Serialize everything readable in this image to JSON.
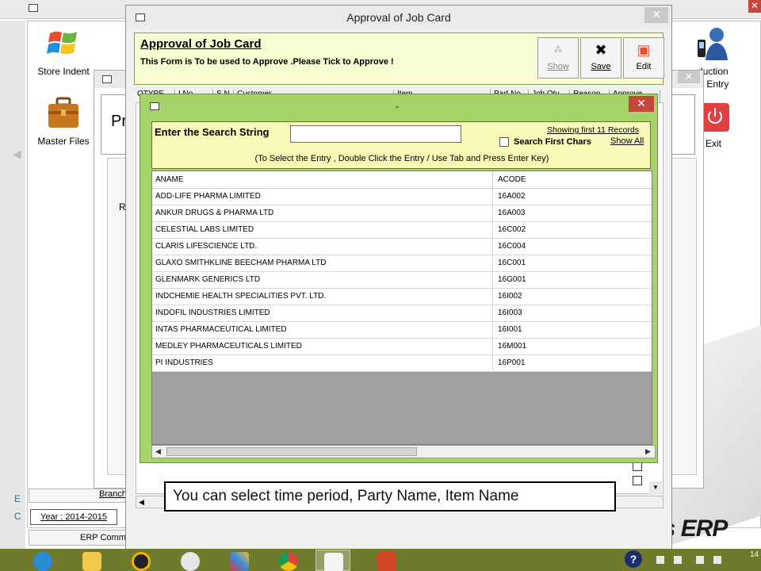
{
  "colors": {
    "search_dialog_bg": "#a6d46a",
    "search_panel_bg": "#fafab8",
    "header_panel_bg": "#f7fdd0",
    "close_red": "#c7463b",
    "taskbar": "#6f7a2a"
  },
  "background": {
    "desktop_icons": [
      {
        "label": "Store Indent",
        "icon": "windows-logo-icon"
      },
      {
        "label": "Master Files",
        "icon": "briefcase-icon"
      }
    ],
    "right_icon_text_1": "duction",
    "right_icon_text_2": "ing Entry",
    "exit_label": "Exit",
    "left_letters": [
      "E",
      "C"
    ],
    "status_branch": "Branch",
    "status_year": "Year : 2014-2015",
    "status_erp": "ERP Commo",
    "brand_text": "ys ERP",
    "mid_title_fragment": "Pr",
    "mid_letter_r": "R",
    "mid_letter_c": "C"
  },
  "approval": {
    "window_title": "Approval of Job Card",
    "form_title": "Approval of Job Card",
    "form_subtitle": "This Form is To be used to Approve .Please Tick to Approve !",
    "buttons": {
      "show": "Show",
      "save": "Save",
      "edit": "Edit"
    },
    "table_headers": [
      "OTYPE",
      "I No",
      "S.N",
      "Customer",
      "Item",
      "Part No",
      "Job Qty",
      "Reason",
      "Approve"
    ]
  },
  "search": {
    "title_dash": "-",
    "label": "Enter the Search String",
    "input_value": "",
    "showing_text": "Showing first 11 Records",
    "first_chars_label": "Search First Chars",
    "show_all": "Show All",
    "hint": "(To Select the Entry , Double Click the Entry / Use Tab and Press Enter Key)",
    "columns": [
      "ANAME",
      "ACODE"
    ],
    "rows": [
      {
        "aname": "ADD-LIFE PHARMA LIMITED",
        "acode": "16A002"
      },
      {
        "aname": "ANKUR DRUGS & PHARMA LTD",
        "acode": "16A003"
      },
      {
        "aname": "CELESTIAL LABS LIMITED",
        "acode": "16C002"
      },
      {
        "aname": "CLARIS LIFESCIENCE LTD.",
        "acode": "16C004"
      },
      {
        "aname": "GLAXO SMITHKLINE BEECHAM PHARMA LTD",
        "acode": "16C001"
      },
      {
        "aname": "GLENMARK GENERICS LTD",
        "acode": "16G001"
      },
      {
        "aname": "INDCHEMIE HEALTH SPECIALITIES PVT. LTD.",
        "acode": "16I002"
      },
      {
        "aname": "INDOFIL INDUSTRIES LIMITED",
        "acode": "16I003"
      },
      {
        "aname": "INTAS PHARMACEUTICAL LIMITED",
        "acode": "16I001"
      },
      {
        "aname": "MEDLEY PHARMACEUTICALS LIMITED",
        "acode": "16M001"
      },
      {
        "aname": "PI INDUSTRIES",
        "acode": "16P001"
      }
    ]
  },
  "caption": "You can select time period, Party Name, Item Name",
  "taskbar": {
    "clock": "14",
    "items": [
      "internet-explorer-icon",
      "file-explorer-icon",
      "media-icon",
      "hp-icon",
      "puzzle-app-icon",
      "chrome-icon",
      "erp-window-icon",
      "powerpoint-icon"
    ]
  }
}
